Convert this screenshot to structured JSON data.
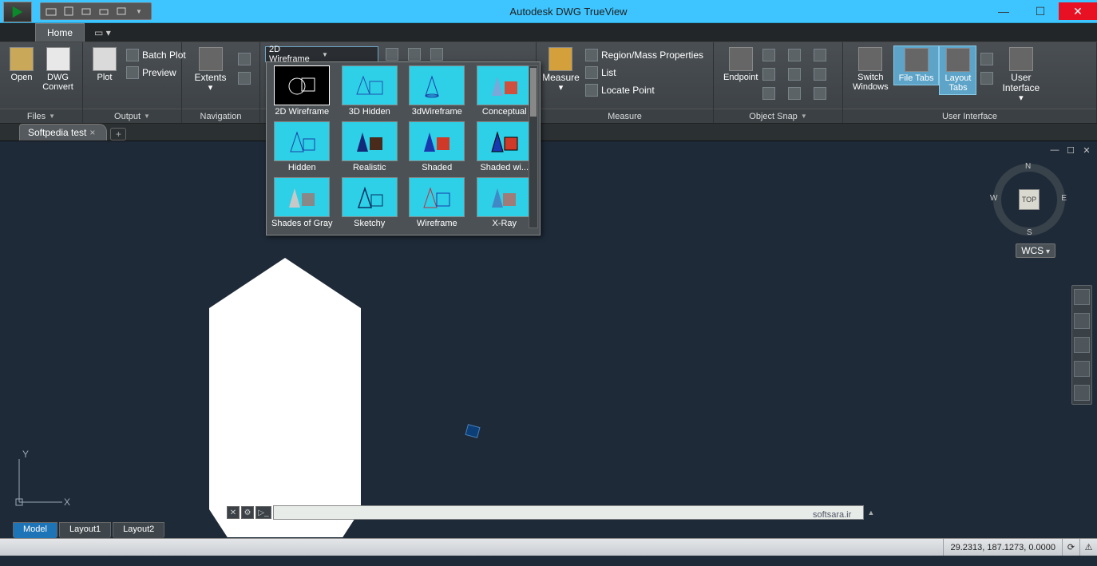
{
  "app": {
    "title": "Autodesk DWG TrueView"
  },
  "tabs": {
    "home": "Home"
  },
  "ribbon": {
    "files": {
      "title": "Files",
      "open": "Open",
      "dwgconvert": "DWG\nConvert"
    },
    "output": {
      "title": "Output",
      "plot": "Plot",
      "batchplot": "Batch Plot",
      "preview": "Preview"
    },
    "navigation": {
      "title": "Navigation",
      "extents": "Extents"
    },
    "visualstyle": {
      "dd": "2D Wireframe"
    },
    "measure": {
      "title": "Measure",
      "measure": "Measure",
      "region": "Region/Mass Properties",
      "list": "List",
      "locate": "Locate Point"
    },
    "osnap": {
      "title": "Object Snap",
      "endpoint": "Endpoint"
    },
    "ui": {
      "title": "User Interface",
      "switch": "Switch\nWindows",
      "filetabs": "File Tabs",
      "layouttabs": "Layout\nTabs",
      "userif": "User\nInterface"
    }
  },
  "gallery": {
    "items": [
      "2D Wireframe",
      "3D Hidden",
      "3dWireframe",
      "Conceptual",
      "Hidden",
      "Realistic",
      "Shaded",
      "Shaded wi...",
      "Shades of Gray",
      "Sketchy",
      "Wireframe",
      "X-Ray"
    ]
  },
  "filetab": {
    "name": "Softpedia test"
  },
  "viewcube": {
    "top": "TOP",
    "n": "N",
    "s": "S",
    "e": "E",
    "w": "W",
    "wcs": "WCS"
  },
  "layouts": {
    "model": "Model",
    "l1": "Layout1",
    "l2": "Layout2"
  },
  "axis": {
    "x": "X",
    "y": "Y"
  },
  "cmdline": {
    "placeholder": ""
  },
  "watermark": "softsara.ir",
  "status": {
    "coords": "29.2313, 187.1273, 0.0000"
  }
}
